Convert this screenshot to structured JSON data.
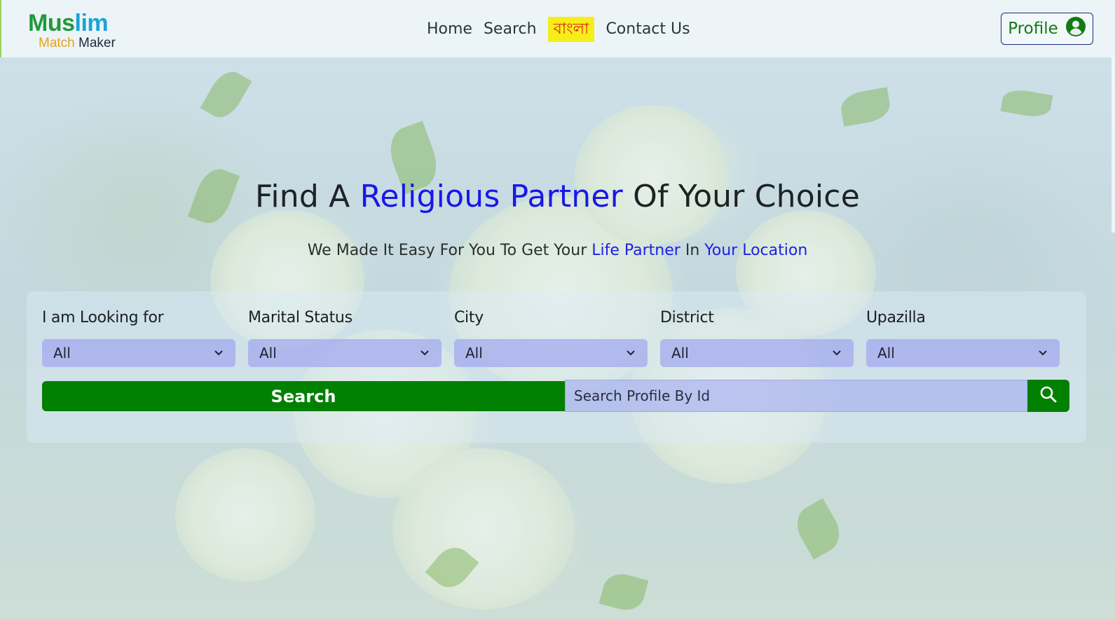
{
  "logo": {
    "word1a": "Mus",
    "word1b": "lim",
    "word2a": "Match",
    "word2b": "Maker"
  },
  "nav": {
    "items": [
      "Home",
      "Search",
      "বাংলা",
      "Contact Us"
    ]
  },
  "profile": {
    "label": "Profile",
    "icon": "user-circle-icon"
  },
  "hero": {
    "title_before": "Find A ",
    "title_highlight": "Religious Partner",
    "title_after": " Of Your Choice",
    "sub_before": "We Made It Easy For You To Get Your ",
    "sub_hl1": "Life Partner",
    "sub_mid": " In ",
    "sub_hl2": "Your Location"
  },
  "filters": [
    {
      "label": "I am Looking for",
      "value": "All"
    },
    {
      "label": "Marital Status",
      "value": "All"
    },
    {
      "label": "City",
      "value": "All"
    },
    {
      "label": "District",
      "value": "All"
    },
    {
      "label": "Upazilla",
      "value": "All"
    }
  ],
  "search": {
    "button_label": "Search",
    "id_placeholder": "Search Profile By Id",
    "id_button_icon": "search-icon"
  },
  "colors": {
    "brand_green": "#018001",
    "highlight_blue": "#1818e8",
    "lang_bg": "#f5ee1a",
    "lang_text": "#d8261b"
  }
}
